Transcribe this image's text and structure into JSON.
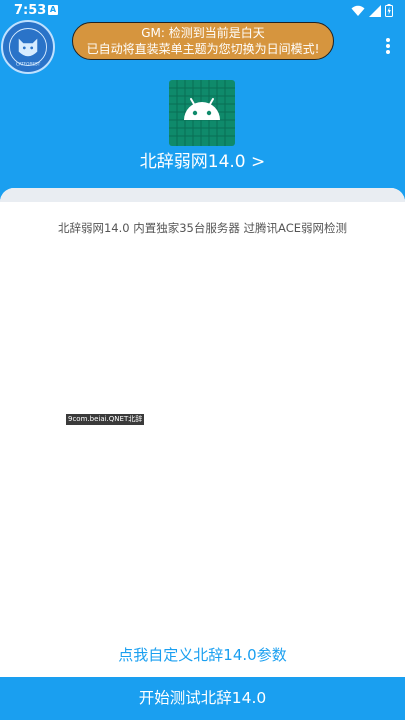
{
  "status_bar": {
    "time": "7:53",
    "notif_icon_letter": "A",
    "icons": [
      "wifi-icon",
      "signal-icon",
      "battery-icon"
    ]
  },
  "logo": {
    "icon": "cat-logo-icon",
    "text_bottom": "CATFOREST"
  },
  "toast": {
    "line1": "GM: 检测到当前是白天",
    "line2": "已自动将直装菜单主题为您切换为日间模式!"
  },
  "menu": {
    "icon": "more-vert-icon"
  },
  "app": {
    "icon": "android-icon",
    "title": "北辞弱网14.0 >"
  },
  "main": {
    "description": "北辞弱网14.0 内置独家35台服务器 过腾讯ACE弱网检测",
    "watermark": "9com.beiai.QNET北辞",
    "customize_link": "点我自定义北辞14.0参数",
    "start_button": "开始测试北辞14.0"
  },
  "colors": {
    "primary": "#1a9ff0",
    "toast_bg": "#d6953e",
    "android_bg": "#0f8a6b"
  }
}
